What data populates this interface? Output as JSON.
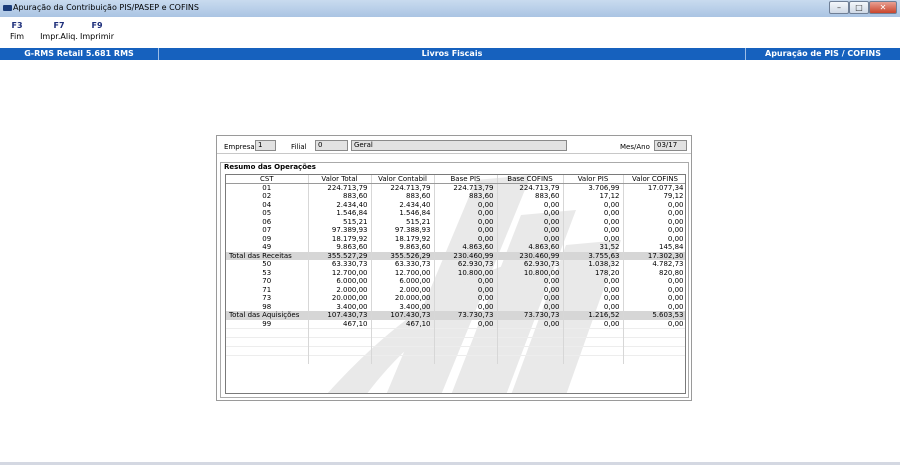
{
  "window": {
    "title": "Apuração da Contribuição PIS/PASEP e COFINS",
    "controls": {
      "minimize": "–",
      "maximize": "□",
      "close": "✕"
    }
  },
  "function_keys": [
    {
      "key": "F3",
      "label": "Fim"
    },
    {
      "key": "F7",
      "label": "Impr.Aliq."
    },
    {
      "key": "F9",
      "label": "Imprimir"
    }
  ],
  "header_bar": {
    "left": "G-RMS Retail 5.681 RMS",
    "center": "Livros Fiscais",
    "right": "Apuração de PIS / COFINS"
  },
  "filters": {
    "empresa_label": "Empresa",
    "empresa_value": "1",
    "filial_label": "Filial",
    "filial_value": "0",
    "filial_name": "Geral",
    "mes_ano_label": "Mes/Ano",
    "mes_ano_value": "03/17"
  },
  "resumo": {
    "title": "Resumo das Operações",
    "columns": [
      "CST",
      "Valor Total",
      "Valor Contabil",
      "Base PIS",
      "Base COFINS",
      "Valor PIS",
      "Valor COFINS"
    ],
    "rows": [
      {
        "type": "row",
        "cells": [
          "01",
          "224.713,79",
          "224.713,79",
          "224.713,79",
          "224.713,79",
          "3.706,99",
          "17.077,34"
        ]
      },
      {
        "type": "row",
        "cells": [
          "02",
          "883,60",
          "883,60",
          "883,60",
          "883,60",
          "17,12",
          "79,12"
        ]
      },
      {
        "type": "row",
        "cells": [
          "04",
          "2.434,40",
          "2.434,40",
          "0,00",
          "0,00",
          "0,00",
          "0,00"
        ]
      },
      {
        "type": "row",
        "cells": [
          "05",
          "1.546,84",
          "1.546,84",
          "0,00",
          "0,00",
          "0,00",
          "0,00"
        ]
      },
      {
        "type": "row",
        "cells": [
          "06",
          "515,21",
          "515,21",
          "0,00",
          "0,00",
          "0,00",
          "0,00"
        ]
      },
      {
        "type": "row",
        "cells": [
          "07",
          "97.389,93",
          "97.388,93",
          "0,00",
          "0,00",
          "0,00",
          "0,00"
        ]
      },
      {
        "type": "row",
        "cells": [
          "09",
          "18.179,92",
          "18.179,92",
          "0,00",
          "0,00",
          "0,00",
          "0,00"
        ]
      },
      {
        "type": "row",
        "cells": [
          "49",
          "9.863,60",
          "9.863,60",
          "4.863,60",
          "4.863,60",
          "31,52",
          "145,84"
        ]
      },
      {
        "type": "total",
        "cells": [
          "Total das Receitas",
          "355.527,29",
          "355.526,29",
          "230.460,99",
          "230.460,99",
          "3.755,63",
          "17.302,30"
        ]
      },
      {
        "type": "row",
        "cells": [
          "50",
          "63.330,73",
          "63.330,73",
          "62.930,73",
          "62.930,73",
          "1.038,32",
          "4.782,73"
        ]
      },
      {
        "type": "row",
        "cells": [
          "53",
          "12.700,00",
          "12.700,00",
          "10.800,00",
          "10.800,00",
          "178,20",
          "820,80"
        ]
      },
      {
        "type": "row",
        "cells": [
          "70",
          "6.000,00",
          "6.000,00",
          "0,00",
          "0,00",
          "0,00",
          "0,00"
        ]
      },
      {
        "type": "row",
        "cells": [
          "71",
          "2.000,00",
          "2.000,00",
          "0,00",
          "0,00",
          "0,00",
          "0,00"
        ]
      },
      {
        "type": "row",
        "cells": [
          "73",
          "20.000,00",
          "20.000,00",
          "0,00",
          "0,00",
          "0,00",
          "0,00"
        ]
      },
      {
        "type": "row",
        "cells": [
          "98",
          "3.400,00",
          "3.400,00",
          "0,00",
          "0,00",
          "0,00",
          "0,00"
        ]
      },
      {
        "type": "total",
        "cells": [
          "Total das Aquisições",
          "107.430,73",
          "107.430,73",
          "73.730,73",
          "73.730,73",
          "1.216,52",
          "5.603,53"
        ]
      },
      {
        "type": "row",
        "cells": [
          "99",
          "467,10",
          "467,10",
          "0,00",
          "0,00",
          "0,00",
          "0,00"
        ]
      }
    ]
  },
  "colors": {
    "header_bar": "#1661be",
    "total_row": "#d6d6d6",
    "fkey_text": "#1c2d7a"
  }
}
